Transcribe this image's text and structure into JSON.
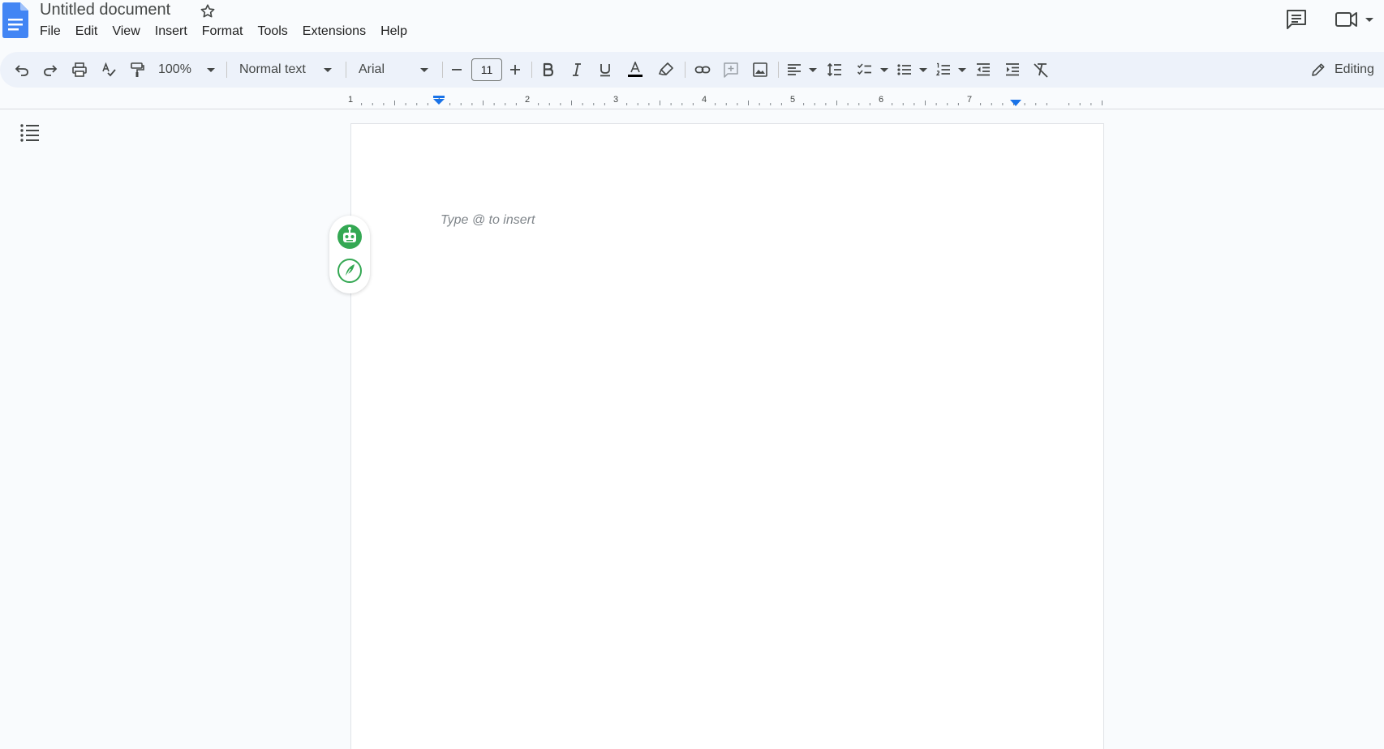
{
  "header": {
    "title": "Untitled document",
    "menu": [
      "File",
      "Edit",
      "View",
      "Insert",
      "Format",
      "Tools",
      "Extensions",
      "Help"
    ]
  },
  "toolbar": {
    "zoom": "100%",
    "style": "Normal text",
    "font": "Arial",
    "font_size": "11",
    "mode": "Editing"
  },
  "ruler": {
    "labels": [
      "1",
      "1",
      "2",
      "3",
      "4",
      "5",
      "6",
      "7"
    ]
  },
  "document": {
    "placeholder": "Type @ to insert"
  },
  "colors": {
    "accent": "#1a73e8",
    "toolbar_bg": "#edf2fa",
    "widget_green": "#34a853"
  },
  "icons": [
    "docs-logo-icon",
    "star-icon",
    "comments-icon",
    "meet-icon",
    "undo-icon",
    "redo-icon",
    "print-icon",
    "spellcheck-icon",
    "paint-format-icon",
    "bold-icon",
    "italic-icon",
    "underline-icon",
    "text-color-icon",
    "highlight-icon",
    "link-icon",
    "add-comment-icon",
    "image-icon",
    "align-left-icon",
    "line-spacing-icon",
    "checklist-icon",
    "bulleted-list-icon",
    "numbered-list-icon",
    "decrease-indent-icon",
    "increase-indent-icon",
    "clear-formatting-icon",
    "pencil-icon",
    "outline-icon",
    "robot-icon",
    "quill-icon"
  ]
}
